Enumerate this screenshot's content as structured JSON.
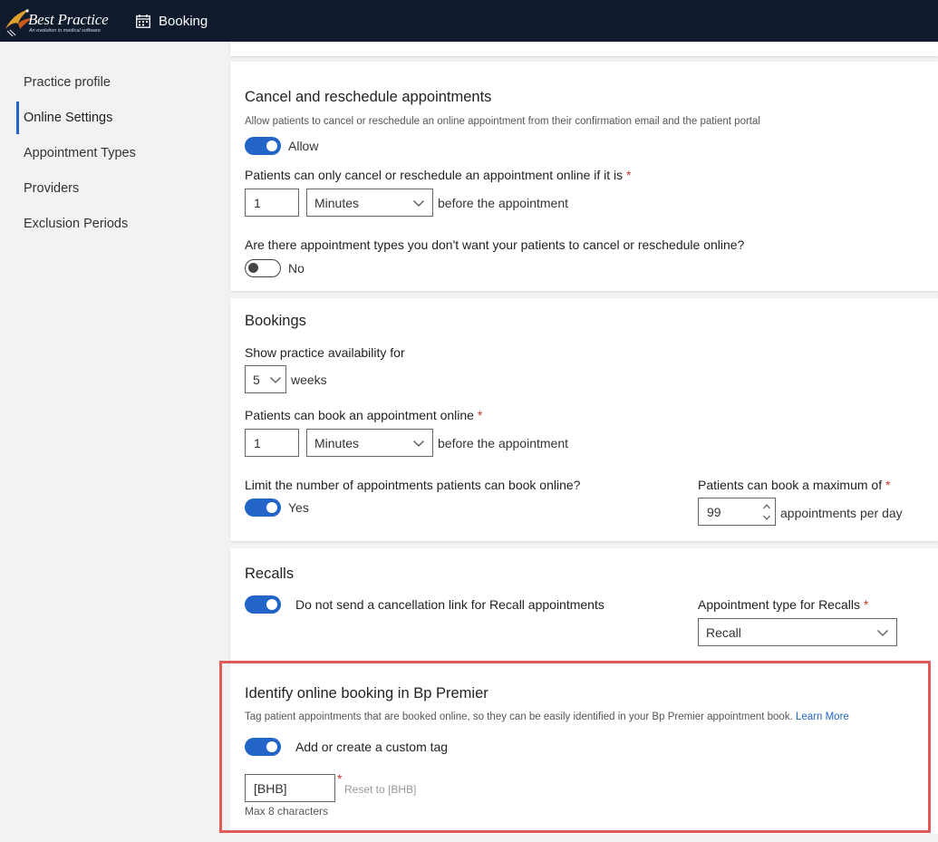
{
  "app": {
    "logo_text": "Best Practice",
    "logo_tagline": "An evolution in medical software",
    "nav_booking": "Booking"
  },
  "sidebar": {
    "items": [
      {
        "label": "Practice profile"
      },
      {
        "label": "Online Settings",
        "active": true
      },
      {
        "label": "Appointment Types"
      },
      {
        "label": "Providers"
      },
      {
        "label": "Exclusion Periods"
      }
    ]
  },
  "cancel": {
    "title": "Cancel and reschedule appointments",
    "description": "Allow patients to cancel or reschedule an online appointment from their confirmation email and the patient portal",
    "allow_toggle": {
      "on": true,
      "label": "Allow"
    },
    "limit_label": "Patients can only cancel or reschedule an appointment online if it is",
    "limit_value": "1",
    "limit_unit": "Minutes",
    "limit_suffix": "before the appointment",
    "types_question": "Are there appointment types you don't want your patients to cancel or reschedule online?",
    "types_toggle": {
      "on": false,
      "label": "No"
    }
  },
  "bookings": {
    "title": "Bookings",
    "availability_label": "Show practice availability for",
    "availability_value": "5",
    "availability_unit": "weeks",
    "book_label": "Patients can book an appointment online",
    "book_value": "1",
    "book_unit": "Minutes",
    "book_suffix": "before the appointment",
    "limit_question": "Limit the number of appointments patients can book online?",
    "limit_toggle": {
      "on": true,
      "label": "Yes"
    },
    "max_label": "Patients can book a maximum of",
    "max_value": "99",
    "max_suffix": "appointments per day"
  },
  "recalls": {
    "title": "Recalls",
    "toggle": {
      "on": true,
      "label": "Do not send a cancellation link for Recall appointments"
    },
    "type_label": "Appointment type for Recalls",
    "type_value": "Recall"
  },
  "identify": {
    "title": "Identify online booking in Bp Premier",
    "description": "Tag patient appointments that are booked online, so they can be easily identified in your Bp Premier appointment book.",
    "learn_more": "Learn More",
    "toggle": {
      "on": true,
      "label": "Add or create a custom tag"
    },
    "tag_value": "[BHB]",
    "reset_label": "Reset to [BHB]",
    "hint": "Max 8 characters"
  },
  "required_mark": "*",
  "colors": {
    "topbar": "#0f1b2d",
    "accent": "#2264c8",
    "highlight": "#e05a5a",
    "required": "#c0392b"
  }
}
